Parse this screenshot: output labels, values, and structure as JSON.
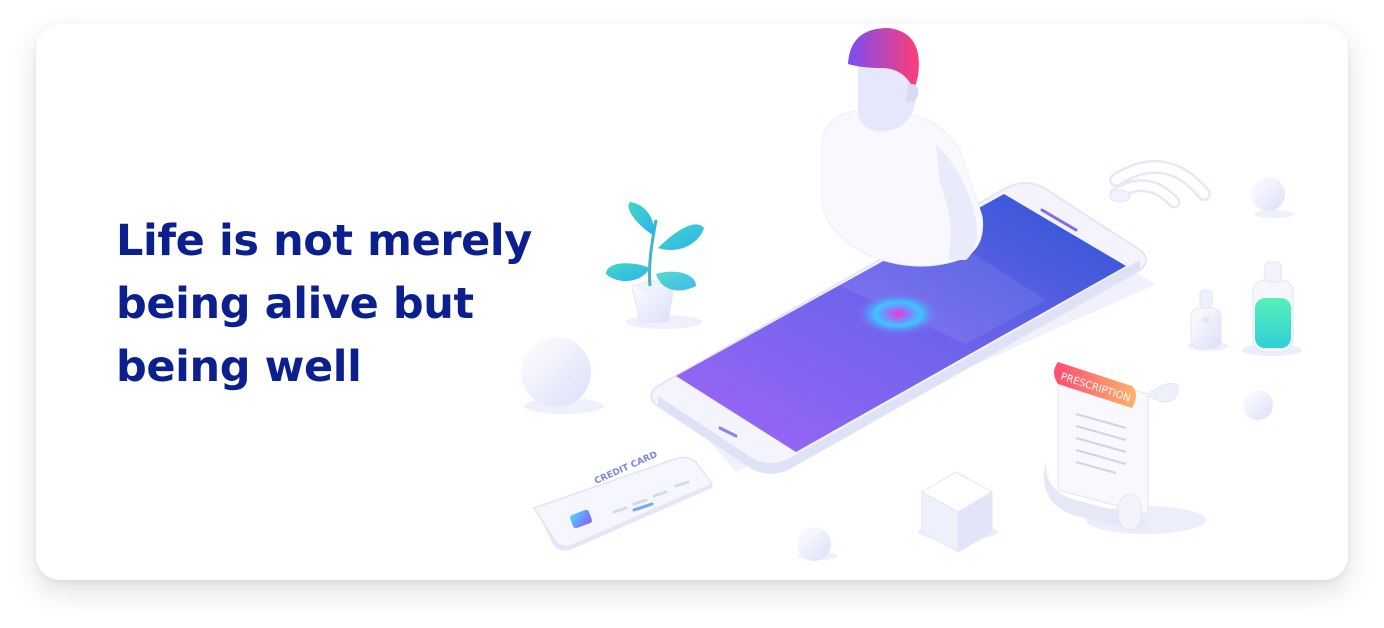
{
  "hero": {
    "quote_lines": [
      "Life is not merely",
      "being alive but",
      "being well"
    ]
  },
  "illustration": {
    "card_label": "CREDIT CARD",
    "prescription_label": "PRESCRIPTION"
  },
  "colors": {
    "heading": "#0b1f8f",
    "screen_start": "#9e63f5",
    "screen_end": "#2d5ad6",
    "hair_start": "#7a4df0",
    "hair_end": "#ff3f7a",
    "bottle_liquid": "#3fe0c0",
    "prescription_tag": "#ff5a6e"
  },
  "icons": [
    "plant-icon",
    "wifi-icon",
    "bottle-icon",
    "pill-bottle-icon",
    "credit-card-icon",
    "prescription-icon",
    "cube-icon",
    "sphere-icon"
  ]
}
